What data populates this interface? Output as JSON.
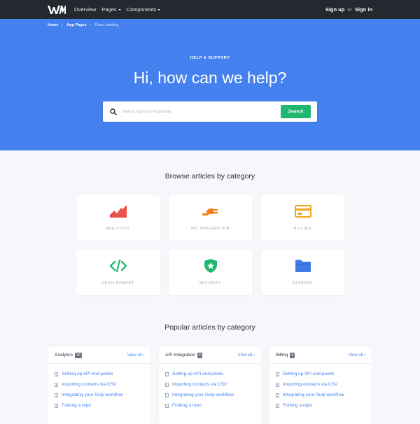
{
  "navbar": {
    "logo_text": "WM",
    "links": [
      {
        "label": "Overview",
        "has_caret": false
      },
      {
        "label": "Pages",
        "has_caret": true
      },
      {
        "label": "Components",
        "has_caret": true
      }
    ],
    "sign_up": "Sign up",
    "or": "or",
    "sign_in": "Sign in"
  },
  "breadcrumb": {
    "items": [
      "Home",
      "App Pages"
    ],
    "current": "Docs Landing"
  },
  "hero": {
    "eyebrow": "HELP & SUPPORT",
    "title": "Hi, how can we help?",
    "search_placeholder": "Search topics or keywords",
    "search_value": "",
    "search_button": "Search"
  },
  "browse": {
    "title": "Browse articles by category",
    "categories": [
      {
        "label": "ANALYTICS",
        "icon": "chart-icon",
        "color": "#e9524a"
      },
      {
        "label": "API INTEGRATION",
        "icon": "plug-icon",
        "color": "#f57f17"
      },
      {
        "label": "BILLING",
        "icon": "credit-card-icon",
        "color": "#f2a516"
      },
      {
        "label": "DEVELOPMENT",
        "icon": "code-icon",
        "color": "#20b86e"
      },
      {
        "label": "SECURITY",
        "icon": "shield-icon",
        "color": "#20b86e"
      },
      {
        "label": "STORAGE",
        "icon": "folder-icon",
        "color": "#3d7ae8"
      }
    ]
  },
  "popular": {
    "title": "Popular articles by category",
    "view_all": "View all ›",
    "groups": [
      {
        "name": "Analytics",
        "count": "10",
        "articles": [
          "Setting up API end-points",
          "Importing contacts via CSV",
          "Integrating your Gulp workflow",
          "Forking a repo"
        ]
      },
      {
        "name": "API Integration",
        "count": "4",
        "articles": [
          "Setting up API end-points",
          "Importing contacts via CSV",
          "Integrating your Gulp workflow",
          "Forking a repo"
        ]
      },
      {
        "name": "Billing",
        "count": "6",
        "articles": [
          "Setting up API end-points",
          "Importing contacts via CSV",
          "Integrating your Gulp workflow",
          "Forking a repo"
        ]
      }
    ]
  },
  "colors": {
    "navbar": "#24282f",
    "hero": "#4480ee",
    "accent_green": "#20b86e",
    "link": "#4480ee"
  }
}
